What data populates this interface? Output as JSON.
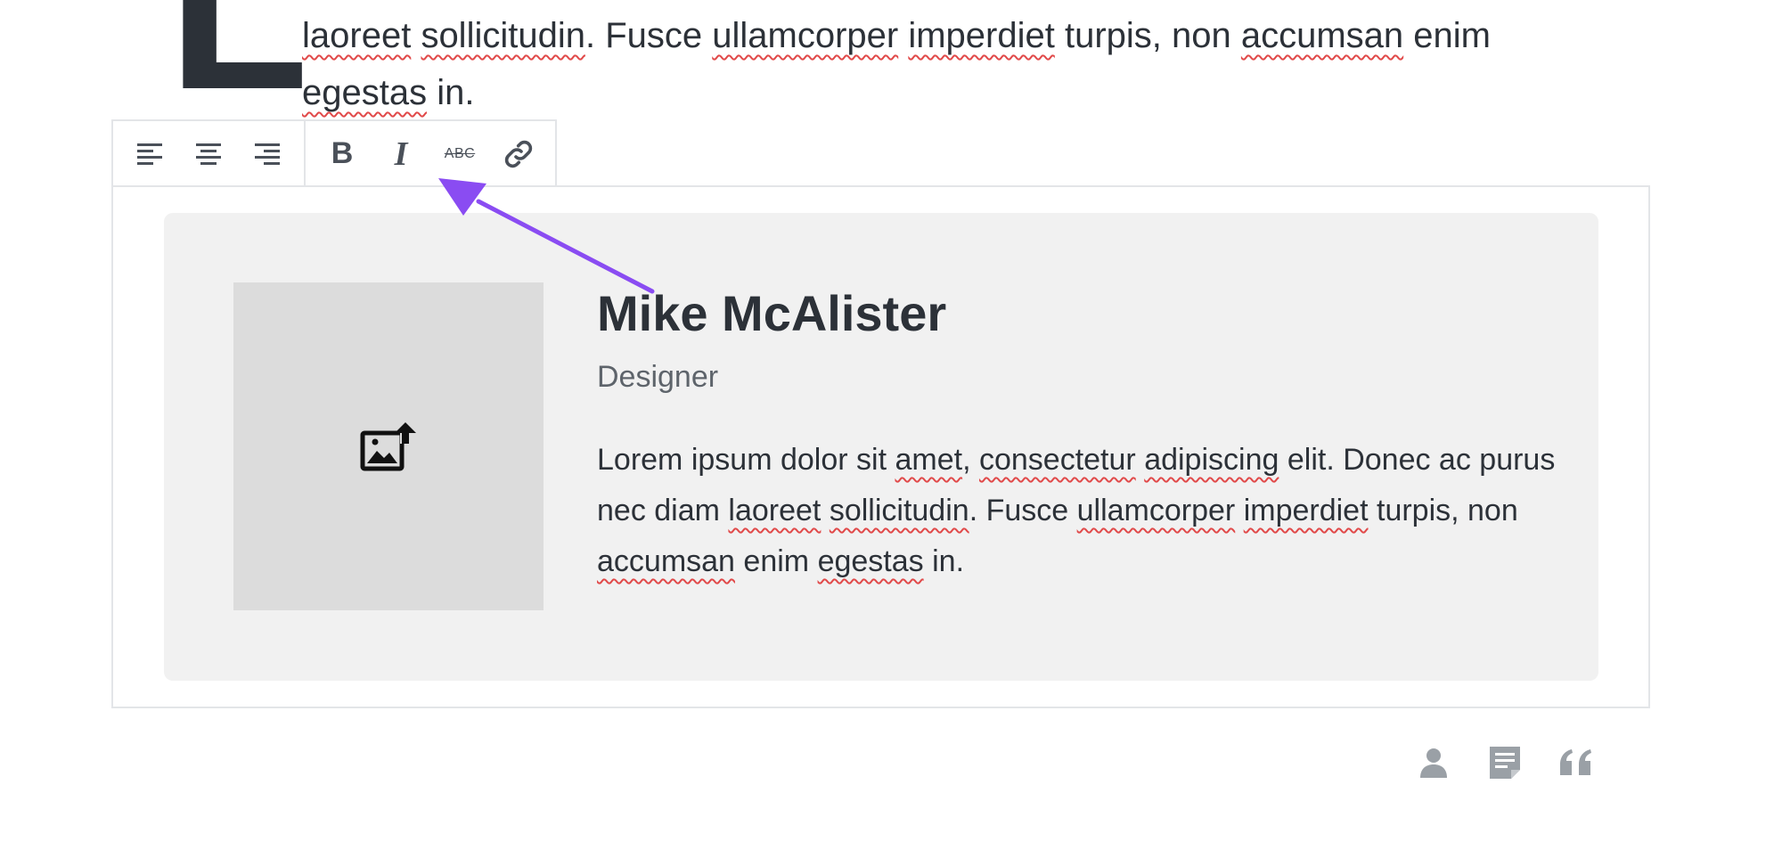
{
  "intro": {
    "drop_cap": "L",
    "segments": [
      {
        "text": "laoreet",
        "spell": true
      },
      {
        "text": " ",
        "spell": false
      },
      {
        "text": "sollicitudin",
        "spell": true
      },
      {
        "text": ". Fusce ",
        "spell": false
      },
      {
        "text": "ullamcorper",
        "spell": true
      },
      {
        "text": " ",
        "spell": false
      },
      {
        "text": "imperdiet",
        "spell": true
      },
      {
        "text": " turpis, non ",
        "spell": false
      },
      {
        "text": "accumsan",
        "spell": true
      },
      {
        "text": " enim ",
        "spell": false
      },
      {
        "text": "egestas",
        "spell": true
      },
      {
        "text": " in.",
        "spell": false
      }
    ]
  },
  "toolbar": {
    "align": [
      {
        "name": "align-left-icon",
        "icon": "align-left"
      },
      {
        "name": "align-center-icon",
        "icon": "align-center"
      },
      {
        "name": "align-right-icon",
        "icon": "align-right"
      }
    ],
    "format": {
      "bold": "B",
      "italic": "I",
      "strikethrough": "ABC",
      "link_icon": "link-icon"
    }
  },
  "card": {
    "image_icon": "add-photo-icon",
    "name": "Mike McAlister",
    "role": "Designer",
    "bio_segments": [
      {
        "text": "Lorem ipsum dolor sit ",
        "spell": false
      },
      {
        "text": "amet",
        "spell": true
      },
      {
        "text": ", ",
        "spell": false
      },
      {
        "text": "consectetur",
        "spell": true
      },
      {
        "text": " ",
        "spell": false
      },
      {
        "text": "adipiscing",
        "spell": true
      },
      {
        "text": " elit. Donec ac purus nec diam ",
        "spell": false
      },
      {
        "text": "laoreet",
        "spell": true
      },
      {
        "text": " ",
        "spell": false
      },
      {
        "text": "sollicitudin",
        "spell": true
      },
      {
        "text": ". Fusce ",
        "spell": false
      },
      {
        "text": "ullamcorper",
        "spell": true
      },
      {
        "text": " ",
        "spell": false
      },
      {
        "text": "imperdiet",
        "spell": true
      },
      {
        "text": " turpis, non ",
        "spell": false
      },
      {
        "text": "accumsan",
        "spell": true
      },
      {
        "text": " enim ",
        "spell": false
      },
      {
        "text": "egestas",
        "spell": true
      },
      {
        "text": " in.",
        "spell": false
      }
    ]
  },
  "block_icons": [
    {
      "name": "person-icon"
    },
    {
      "name": "notes-icon"
    },
    {
      "name": "quote-icon"
    }
  ],
  "colors": {
    "text": "#2c3138",
    "muted": "#5e646b",
    "icon_gray": "#9aa0a6",
    "card_bg": "#f1f1f1",
    "placeholder_bg": "#dcdcdc",
    "frame_border": "#e3e5e8",
    "annotation": "#8a4cf2",
    "spellcheck": "#e14a4a"
  }
}
